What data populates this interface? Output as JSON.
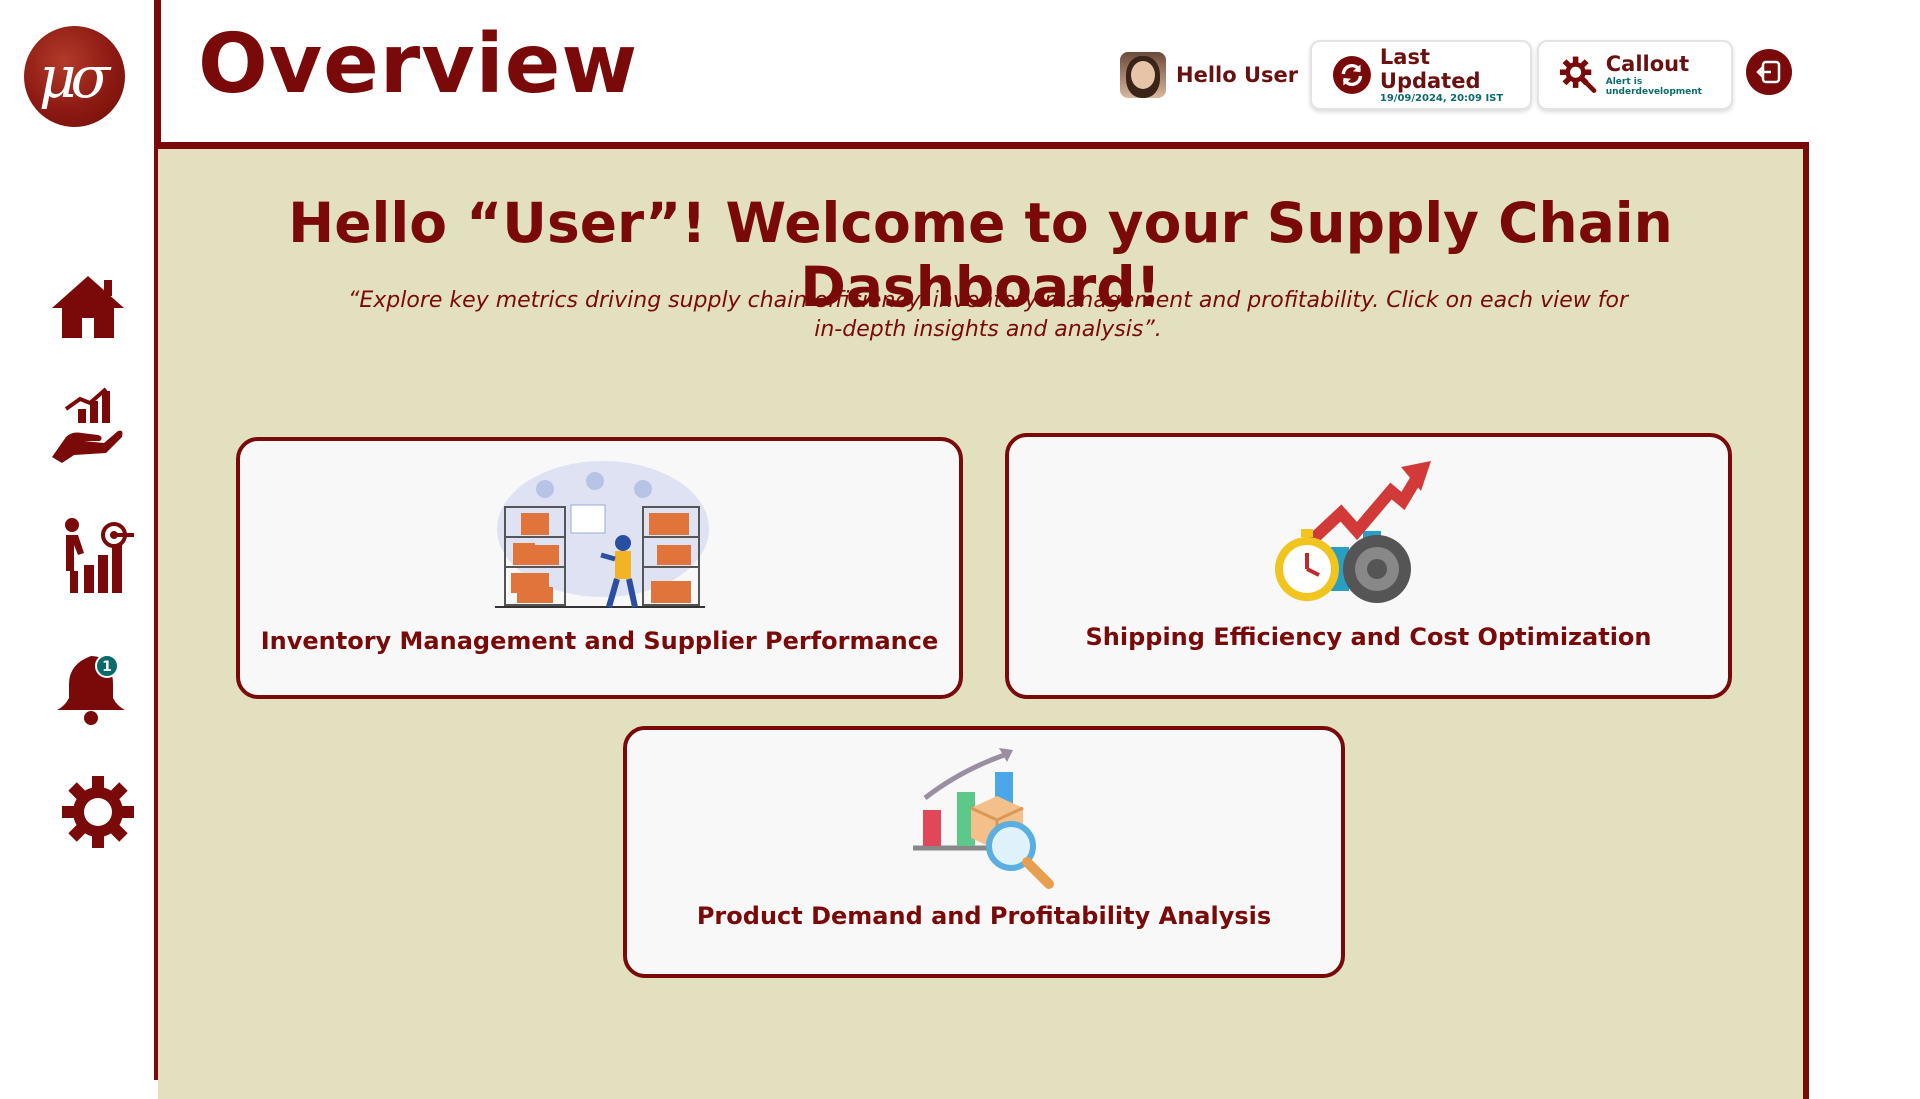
{
  "header": {
    "title": "Overview",
    "user_greeting": "Hello User",
    "last_updated_label": "Last Updated",
    "last_updated_value": "19/09/2024, 20:09 IST",
    "callout_label": "Callout",
    "callout_status": "Alert is underdevelopment"
  },
  "sidebar": {
    "logo_text": "μσ",
    "items": [
      {
        "icon": "home-icon"
      },
      {
        "icon": "hand-chart-icon"
      },
      {
        "icon": "growth-target-icon"
      },
      {
        "icon": "bell-icon",
        "badge": "1"
      },
      {
        "icon": "gear-icon"
      }
    ]
  },
  "main": {
    "welcome": "Hello “User”! Welcome to your Supply Chain Dashboard!",
    "subtitle": "“Explore key metrics driving supply chain efficiency, inventory management and profitability. Click on each view for in-depth insights and analysis”.",
    "tiles": [
      {
        "label": "Inventory Management and Supplier Performance",
        "icon": "warehouse-icon"
      },
      {
        "label": "Shipping Efficiency and Cost Optimization",
        "icon": "stopwatch-growth-icon"
      },
      {
        "label": "Product Demand and Profitability Analysis",
        "icon": "demand-analysis-icon"
      }
    ]
  },
  "colors": {
    "brand": "#7a0a0a",
    "panel_background": "#e2e0be",
    "accent_teal": "#0b6b6b"
  }
}
